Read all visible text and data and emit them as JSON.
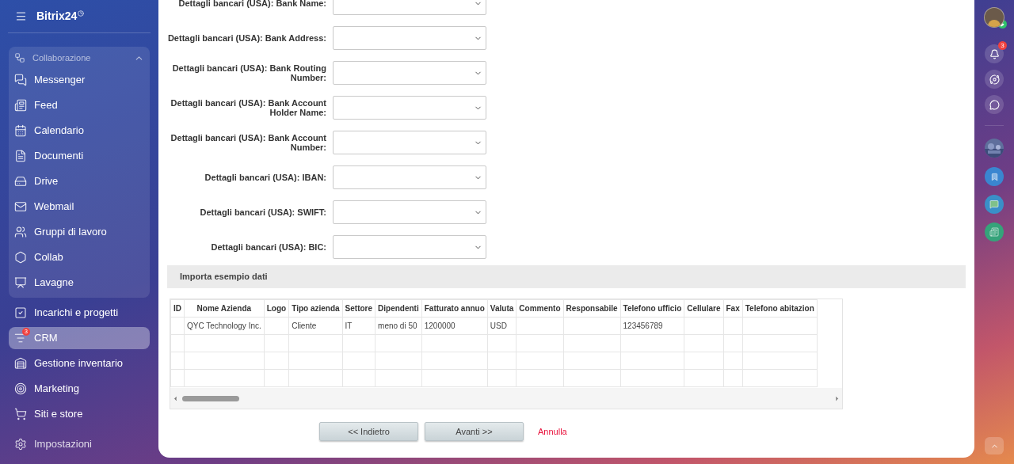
{
  "sidebar": {
    "logo": "Bitrix24",
    "group": {
      "title": "Collaborazione",
      "expanded": true,
      "items": [
        {
          "label": "Messenger",
          "kind": "messenger",
          "selected": false
        },
        {
          "label": "Feed",
          "kind": "feed",
          "selected": false
        },
        {
          "label": "Calendario",
          "kind": "calendar",
          "selected": false
        },
        {
          "label": "Documenti",
          "kind": "document",
          "selected": false
        },
        {
          "label": "Drive",
          "kind": "drive",
          "selected": false
        },
        {
          "label": "Webmail",
          "kind": "mail",
          "selected": false
        },
        {
          "label": "Gruppi di lavoro",
          "kind": "users",
          "selected": false
        },
        {
          "label": "Collab",
          "kind": "hexagon",
          "selected": false
        },
        {
          "label": "Lavagne",
          "kind": "board",
          "selected": false
        }
      ]
    },
    "items": [
      {
        "label": "Incarichi e progetti",
        "kind": "task",
        "selected": false
      },
      {
        "label": "CRM",
        "kind": "crm",
        "selected": true,
        "badge": "3"
      },
      {
        "label": "Gestione inventario",
        "kind": "warehouse",
        "selected": false
      },
      {
        "label": "Marketing",
        "kind": "target",
        "selected": false
      },
      {
        "label": "Siti e store",
        "kind": "cart",
        "selected": false
      }
    ],
    "settings": "Impostazioni"
  },
  "form": {
    "fields": [
      {
        "label": "Dettagli bancari (USA): Bank Name:"
      },
      {
        "label": "Dettagli bancari (USA): Bank Address:"
      },
      {
        "label": "Dettagli bancari (USA): Bank Routing Number:"
      },
      {
        "label": "Dettagli bancari (USA): Bank Account Holder Name:"
      },
      {
        "label": "Dettagli bancari (USA): Bank Account Number:"
      },
      {
        "label": "Dettagli bancari (USA): IBAN:"
      },
      {
        "label": "Dettagli bancari (USA): SWIFT:"
      },
      {
        "label": "Dettagli bancari (USA): BIC:"
      }
    ]
  },
  "section": {
    "title": "Importa esempio dati"
  },
  "table": {
    "columns": [
      "ID",
      "Nome Azienda",
      "Logo",
      "Tipo azienda",
      "Settore",
      "Dipendenti",
      "Fatturato annuo",
      "Valuta",
      "Commento",
      "Responsabile",
      "Telefono ufficio",
      "Cellulare",
      "Fax",
      "Telefono abitazion"
    ],
    "rows": [
      {
        "cells": [
          null,
          "QYC Technology Inc.",
          null,
          "Cliente",
          "IT",
          "meno di 50",
          "1200000",
          "USD",
          null,
          null,
          "123456789",
          null,
          null,
          null
        ]
      }
    ]
  },
  "buttons": [
    {
      "label": "<< Indietro",
      "kind": "button"
    },
    {
      "label": "Avanti >>",
      "kind": "button"
    },
    {
      "label": "Annulla",
      "kind": "link"
    }
  ],
  "right_bar": {
    "notifications_badge": "3"
  }
}
